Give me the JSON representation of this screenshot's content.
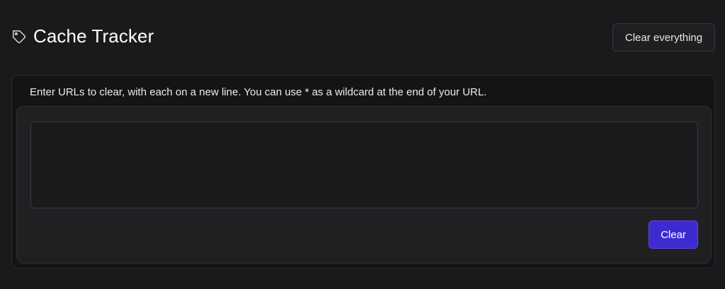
{
  "header": {
    "icon": "tag-icon",
    "title": "Cache Tracker",
    "clear_all_label": "Clear everything"
  },
  "panel": {
    "instructions": "Enter URLs to clear, with each on a new line. You can use * as a wildcard at the end of your URL.",
    "textarea": {
      "value": "",
      "placeholder": ""
    },
    "clear_label": "Clear"
  },
  "colors": {
    "background": "#1a1a1d",
    "accent": "#3d2bd1"
  }
}
